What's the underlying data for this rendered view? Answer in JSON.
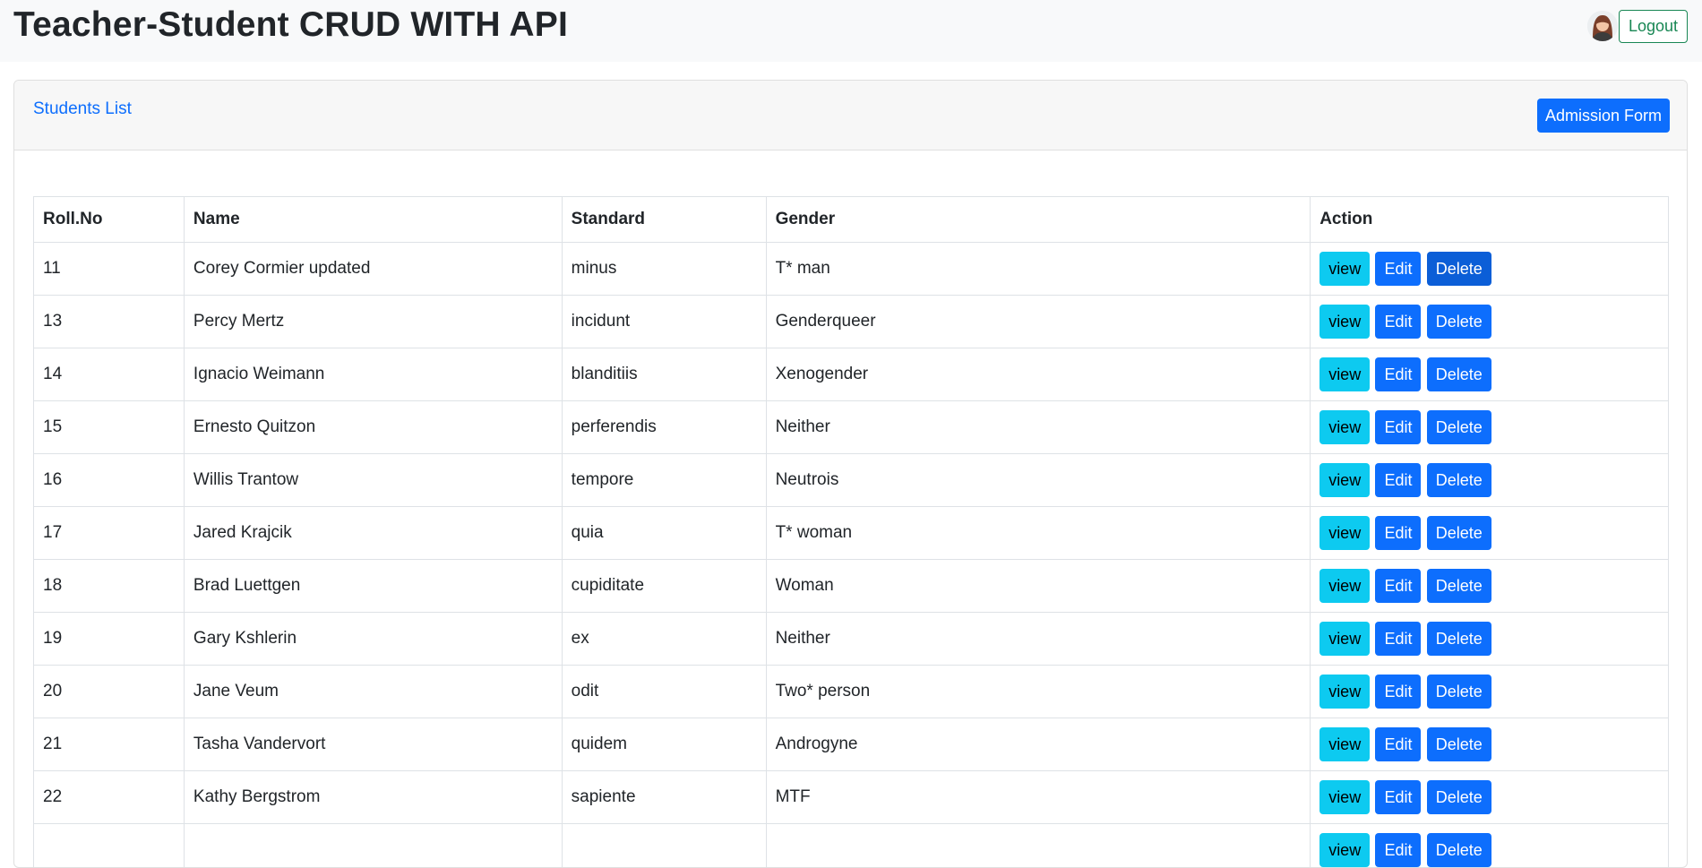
{
  "header": {
    "title": "Teacher-Student CRUD WITH API",
    "logout_label": "Logout"
  },
  "card": {
    "title": "Students List",
    "admission_label": "Admission Form"
  },
  "table": {
    "columns": [
      "Roll.No",
      "Name",
      "Standard",
      "Gender",
      "Action"
    ],
    "actions": {
      "view": "view",
      "edit": "Edit",
      "delete": "Delete"
    },
    "rows": [
      {
        "roll": "11",
        "name": "Corey Cormier updated",
        "standard": "minus",
        "gender": "T* man"
      },
      {
        "roll": "13",
        "name": "Percy Mertz",
        "standard": "incidunt",
        "gender": "Genderqueer"
      },
      {
        "roll": "14",
        "name": "Ignacio Weimann",
        "standard": "blanditiis",
        "gender": "Xenogender"
      },
      {
        "roll": "15",
        "name": "Ernesto Quitzon",
        "standard": "perferendis",
        "gender": "Neither"
      },
      {
        "roll": "16",
        "name": "Willis Trantow",
        "standard": "tempore",
        "gender": "Neutrois"
      },
      {
        "roll": "17",
        "name": "Jared Krajcik",
        "standard": "quia",
        "gender": "T* woman"
      },
      {
        "roll": "18",
        "name": "Brad Luettgen",
        "standard": "cupiditate",
        "gender": "Woman"
      },
      {
        "roll": "19",
        "name": "Gary Kshlerin",
        "standard": "ex",
        "gender": "Neither"
      },
      {
        "roll": "20",
        "name": "Jane Veum",
        "standard": "odit",
        "gender": "Two* person"
      },
      {
        "roll": "21",
        "name": "Tasha Vandervort",
        "standard": "quidem",
        "gender": "Androgyne"
      },
      {
        "roll": "22",
        "name": "Kathy Bergstrom",
        "standard": "sapiente",
        "gender": "MTF"
      },
      {
        "roll": "",
        "name": "",
        "standard": "",
        "gender": ""
      }
    ]
  },
  "colors": {
    "primary": "#0d6efd",
    "info": "#0dcaf0",
    "success": "#198754",
    "navbar_bg": "#f8f9fa"
  }
}
